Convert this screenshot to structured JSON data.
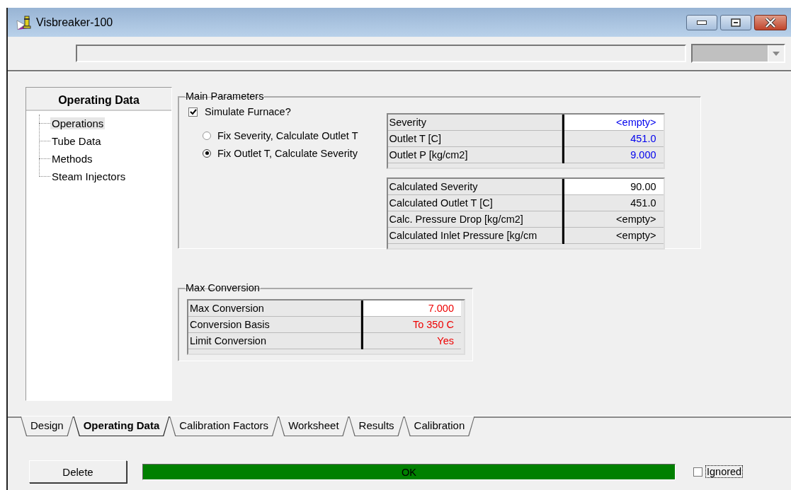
{
  "window": {
    "title": "Visbreaker-100"
  },
  "sidebar": {
    "title": "Operating Data",
    "items": [
      {
        "label": "Operations",
        "selected": true
      },
      {
        "label": "Tube Data",
        "selected": false
      },
      {
        "label": "Methods",
        "selected": false
      },
      {
        "label": "Steam Injectors",
        "selected": false
      }
    ]
  },
  "main_parameters": {
    "title": "Main Parameters",
    "simulate_furnace": {
      "label": "Simulate Furnace?",
      "checked": true
    },
    "modes": [
      {
        "label": "Fix Severity, Calculate Outlet T",
        "selected": false
      },
      {
        "label": "Fix Outlet T, Calculate Severity",
        "selected": true
      }
    ],
    "specs": [
      {
        "label": "Severity",
        "value": "<empty>",
        "kind": "specified",
        "selected": true
      },
      {
        "label": "Outlet T [C]",
        "value": "451.0",
        "kind": "specified",
        "selected": false
      },
      {
        "label": "Outlet P [kg/cm2]",
        "value": "9.000",
        "kind": "specified",
        "selected": false
      }
    ],
    "results": [
      {
        "label": "Calculated Severity",
        "value": "90.00",
        "kind": "calculated",
        "selected": true
      },
      {
        "label": "Calculated Outlet T [C]",
        "value": "451.0",
        "kind": "calculated",
        "selected": false
      },
      {
        "label": "Calc. Pressure Drop [kg/cm2]",
        "value": "<empty>",
        "kind": "calculated",
        "selected": false
      },
      {
        "label": "Calculated Inlet Pressure [kg/cm",
        "value": "<empty>",
        "kind": "calculated",
        "selected": false
      }
    ]
  },
  "max_conversion": {
    "title": "Max Conversion",
    "rows": [
      {
        "label": "Max Conversion",
        "value": "7.000",
        "kind": "default",
        "selected": true
      },
      {
        "label": "Conversion Basis",
        "value": "To 350 C",
        "kind": "default",
        "selected": false
      },
      {
        "label": "Limit Conversion",
        "value": "Yes",
        "kind": "default",
        "selected": false
      }
    ]
  },
  "tabs": [
    {
      "label": "Design",
      "selected": false
    },
    {
      "label": "Operating Data",
      "selected": true
    },
    {
      "label": "Calibration Factors",
      "selected": false
    },
    {
      "label": "Worksheet",
      "selected": false
    },
    {
      "label": "Results",
      "selected": false
    },
    {
      "label": "Calibration",
      "selected": false
    }
  ],
  "footer": {
    "delete_button": "Delete",
    "status": "OK",
    "ignored": {
      "label": "Ignored",
      "checked": false
    }
  }
}
